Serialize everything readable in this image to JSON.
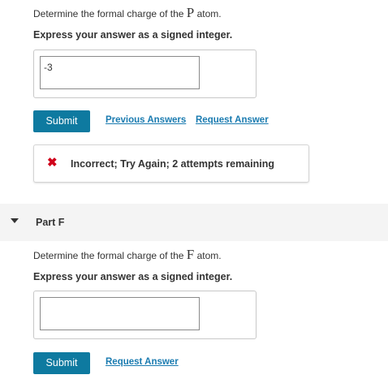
{
  "part_e": {
    "prompt_prefix": "Determine the formal charge of the",
    "prompt_symbol": "P",
    "prompt_suffix": "atom.",
    "instruction": "Express your answer as a signed integer.",
    "answer_value": "-3",
    "submit_label": "Submit",
    "previous_answers_label": "Previous Answers",
    "request_answer_label": "Request Answer",
    "feedback_icon": "x-icon",
    "feedback_message": "Incorrect; Try Again; 2 attempts remaining",
    "feedback_icon_color": "#d0021b"
  },
  "part_f": {
    "title": "Part F",
    "prompt_prefix": "Determine the formal charge of the",
    "prompt_symbol": "F",
    "prompt_suffix": "atom.",
    "instruction": "Express your answer as a signed integer.",
    "answer_value": "",
    "submit_label": "Submit",
    "request_answer_label": "Request Answer"
  },
  "colors": {
    "submit_button": "#0e7aa0",
    "link": "#1a7bb0"
  }
}
